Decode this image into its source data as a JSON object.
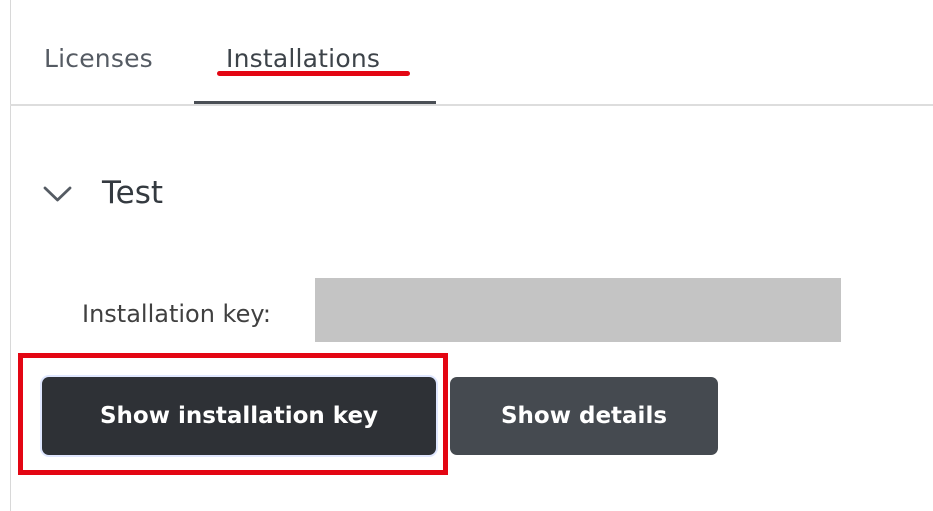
{
  "tabs": [
    {
      "label": "Licenses"
    },
    {
      "label": "Installations"
    }
  ],
  "installation": {
    "name": "Test",
    "key_label": "Installation key:",
    "key_value": "",
    "buttons": {
      "show_installation_key": "Show installation key",
      "show_details": "Show details"
    }
  },
  "icons": {
    "collapse": "chevron-down-icon"
  },
  "colors": {
    "annotation": "#e30613",
    "primary_button": "#2e3136",
    "secondary_button": "#454a50",
    "redaction": "#c4c4c4",
    "active_tab_indicator": "#4a4f55"
  }
}
